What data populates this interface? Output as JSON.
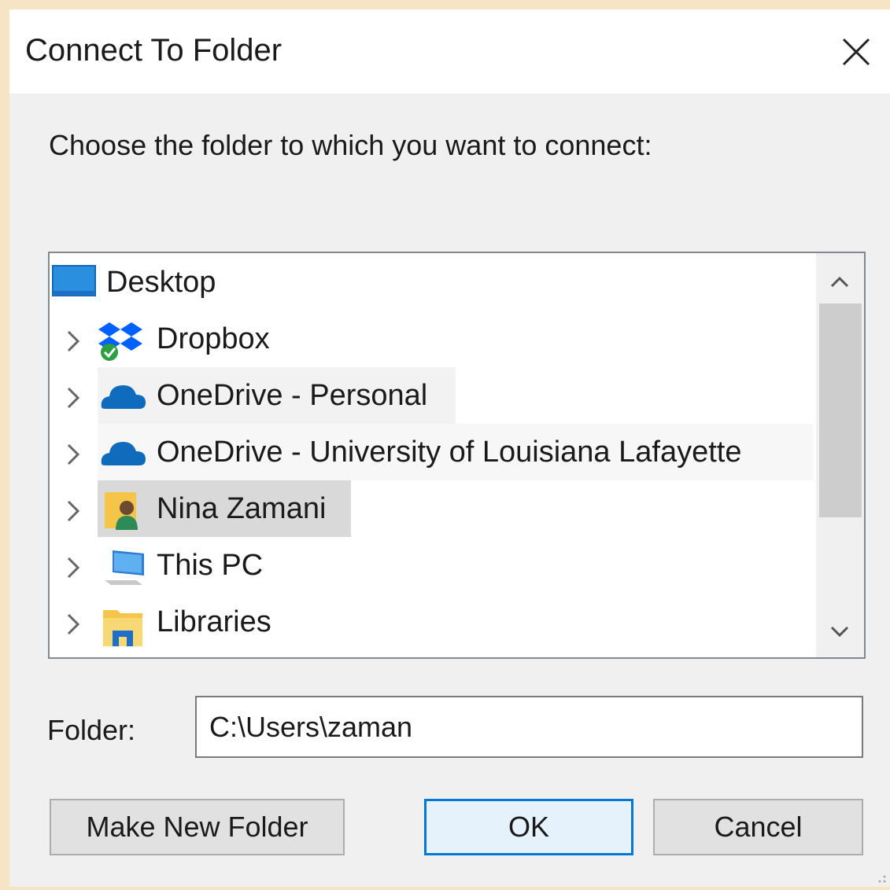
{
  "dialog": {
    "title": "Connect To Folder",
    "close_icon": "close-icon",
    "prompt": "Choose the folder to which you want to connect:"
  },
  "tree": {
    "items": [
      {
        "label": "Desktop",
        "icon": "desktop-icon",
        "expandable": false
      },
      {
        "label": "Dropbox",
        "icon": "dropbox-icon",
        "expandable": true
      },
      {
        "label": "OneDrive - Personal",
        "icon": "onedrive-icon",
        "expandable": true
      },
      {
        "label": "OneDrive - University of Louisiana Lafayette",
        "icon": "onedrive-icon",
        "expandable": true
      },
      {
        "label": "Nina Zamani",
        "icon": "user-folder-icon",
        "expandable": true,
        "selected": true
      },
      {
        "label": "This PC",
        "icon": "computer-icon",
        "expandable": true
      },
      {
        "label": "Libraries",
        "icon": "libraries-icon",
        "expandable": true
      }
    ],
    "scroll_up_icon": "chevron-up-icon",
    "scroll_down_icon": "chevron-down-icon"
  },
  "folder": {
    "label": "Folder:",
    "value": "C:\\Users\\zaman"
  },
  "buttons": {
    "make_new_folder": "Make New Folder",
    "ok": "OK",
    "cancel": "Cancel"
  },
  "colors": {
    "accent": "#0078d7",
    "selection": "#d9d9d9",
    "onedrive": "#0f6cbd",
    "dropbox": "#0061fe"
  }
}
